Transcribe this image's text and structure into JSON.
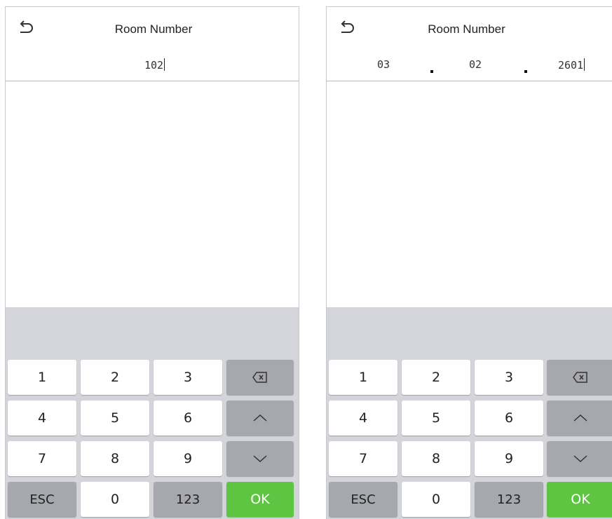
{
  "screens": [
    {
      "title": "Room Number",
      "input": {
        "value": "102"
      },
      "keys": {
        "k1": "1",
        "k2": "2",
        "k3": "3",
        "k4": "4",
        "k5": "5",
        "k6": "6",
        "k7": "7",
        "k8": "8",
        "k9": "9",
        "k0": "0",
        "esc": "ESC",
        "mode": "123",
        "ok": "OK"
      }
    },
    {
      "title": "Room Number",
      "input": {
        "part1": "03",
        "part2": "02",
        "part3": "2601"
      },
      "keys": {
        "k1": "1",
        "k2": "2",
        "k3": "3",
        "k4": "4",
        "k5": "5",
        "k6": "6",
        "k7": "7",
        "k8": "8",
        "k9": "9",
        "k0": "0",
        "esc": "ESC",
        "mode": "123",
        "ok": "OK"
      }
    }
  ],
  "icons": {
    "back": "back-arrow-icon",
    "backspace": "backspace-icon",
    "up": "chevron-up-icon",
    "down": "chevron-down-icon"
  },
  "colors": {
    "ok_key": "#5ec542",
    "function_key": "#a6a8ae",
    "keyboard_bg": "#d4d5da"
  }
}
